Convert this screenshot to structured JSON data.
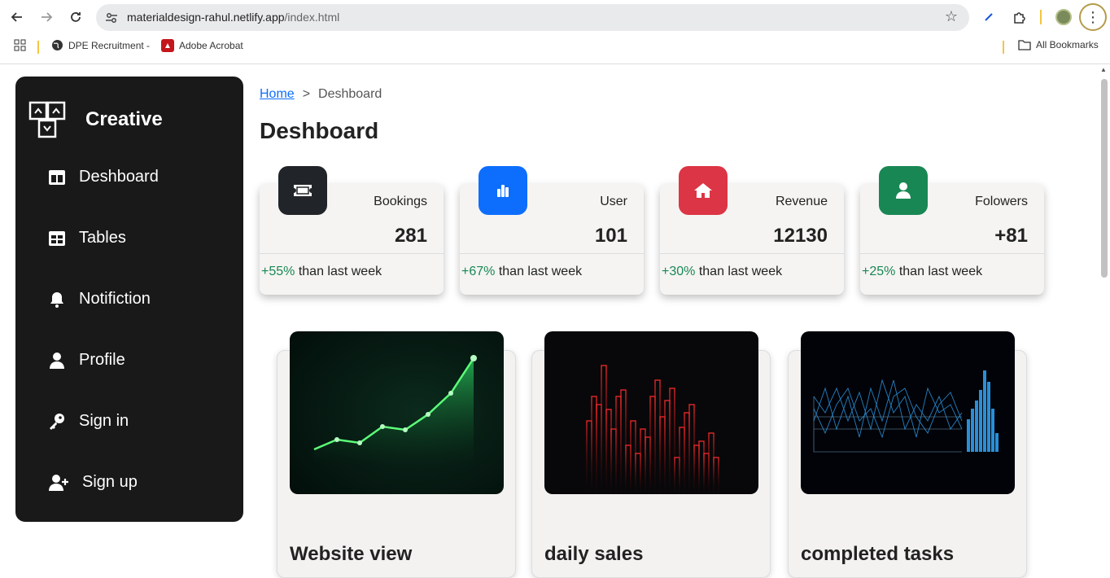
{
  "browser": {
    "url_domain": "materialdesign-rahul.netlify.app",
    "url_path": "/index.html",
    "bookmarks": [
      {
        "label": "DPE Recruitment -"
      },
      {
        "label": "Adobe Acrobat"
      }
    ],
    "all_bookmarks": "All Bookmarks"
  },
  "sidebar": {
    "brand": "Creative",
    "items": [
      {
        "label": "Deshboard",
        "icon": "dashboard-icon"
      },
      {
        "label": "Tables",
        "icon": "table-icon"
      },
      {
        "label": "Notifiction",
        "icon": "bell-icon"
      },
      {
        "label": "Profile",
        "icon": "user-icon"
      },
      {
        "label": "Sign in",
        "icon": "key-icon"
      },
      {
        "label": "Sign up",
        "icon": "user-plus-icon"
      }
    ]
  },
  "breadcrumb": {
    "home": "Home",
    "sep": ">",
    "current": "Deshboard"
  },
  "page_title": "Deshboard",
  "stats": [
    {
      "label": "Bookings",
      "value": "281",
      "pct": "+55%",
      "foot": " than last week",
      "color": "#212529",
      "icon": "ticket-icon"
    },
    {
      "label": "User",
      "value": "101",
      "pct": "+67%",
      "foot": " than last week",
      "color": "#0d6efd",
      "icon": "bar-chart-icon"
    },
    {
      "label": "Revenue",
      "value": "12130",
      "pct": "+30%",
      "foot": " than last week",
      "color": "#dc3545",
      "icon": "home-icon"
    },
    {
      "label": "Folowers",
      "value": "+81",
      "pct": "+25%",
      "foot": " than last week",
      "color": "#198754",
      "icon": "person-icon"
    }
  ],
  "cards": [
    {
      "title": "Website view"
    },
    {
      "title": "daily sales"
    },
    {
      "title": "completed tasks"
    }
  ]
}
